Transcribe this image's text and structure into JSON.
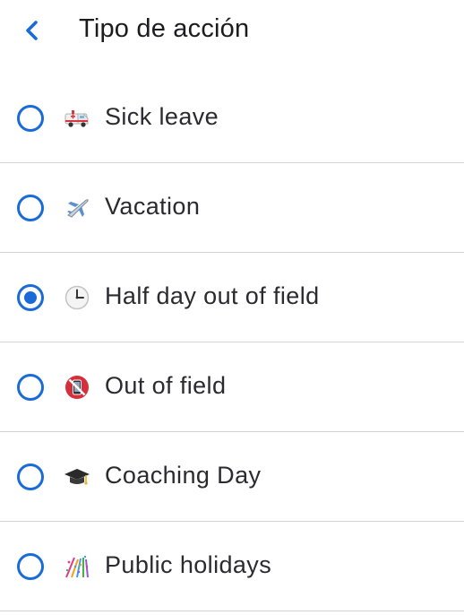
{
  "header": {
    "title": "Tipo de acción",
    "back_icon": "chevron-left-icon",
    "accent_color": "#1a6bd8"
  },
  "options": [
    {
      "label": "Sick leave",
      "icon": "ambulance-icon",
      "selected": false
    },
    {
      "label": "Vacation",
      "icon": "airplane-icon",
      "selected": false
    },
    {
      "label": "Half day out of field",
      "icon": "clock-icon",
      "selected": true
    },
    {
      "label": "Out of field",
      "icon": "no-mobile-phone-icon",
      "selected": false
    },
    {
      "label": "Coaching Day",
      "icon": "graduation-cap-icon",
      "selected": false
    },
    {
      "label": "Public holidays",
      "icon": "confetti-icon",
      "selected": false
    }
  ]
}
